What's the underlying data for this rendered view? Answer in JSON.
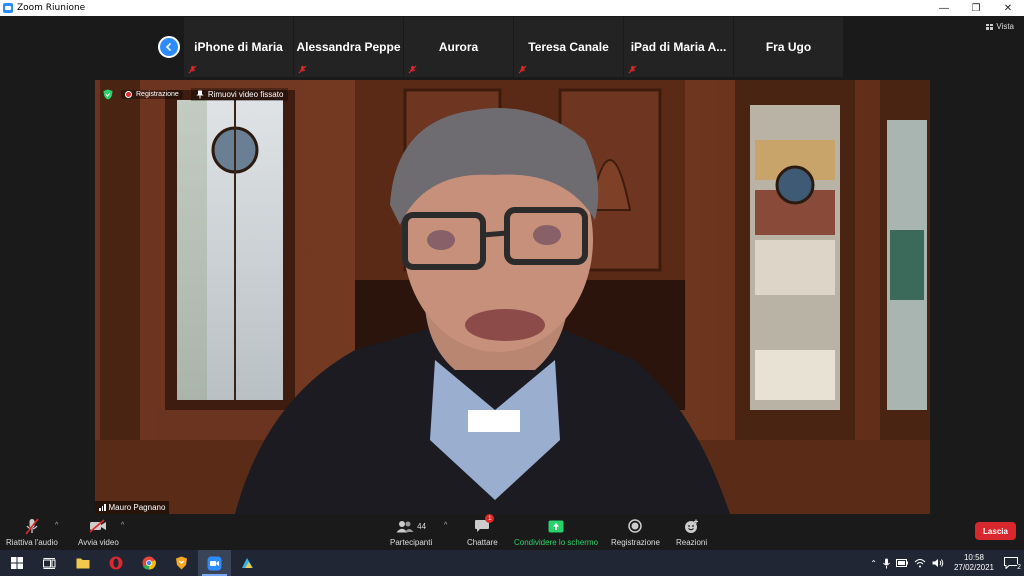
{
  "window": {
    "title": "Zoom Riunione",
    "controls": {
      "minimize": "—",
      "restore": "❐",
      "close": "✕"
    }
  },
  "view_button": {
    "label": "Vista"
  },
  "participants_strip": [
    {
      "name": "iPhone di Maria",
      "muted": true
    },
    {
      "name": "Alessandra Peppe",
      "muted": true
    },
    {
      "name": "Aurora",
      "muted": true
    },
    {
      "name": "Teresa Canale",
      "muted": true
    },
    {
      "name": "iPad di Maria A...",
      "muted": true
    },
    {
      "name": "Fra Ugo",
      "muted": false
    }
  ],
  "main_video": {
    "recording_label": "Registrazione",
    "unpin_label": "Rimuovi video fissato",
    "speaker_name": "Mauro Pagnano"
  },
  "toolbar": {
    "audio_label": "Riattiva l'audio",
    "video_label": "Avvia video",
    "participants_label": "Partecipanti",
    "participants_count": "44",
    "chat_label": "Chattare",
    "chat_badge": "1",
    "share_label": "Condividere lo schermo",
    "record_label": "Registrazione",
    "reactions_label": "Reazioni",
    "leave_label": "Lascia"
  },
  "taskbar": {
    "time": "10:58",
    "date": "27/02/2021",
    "notifications": "2"
  },
  "colors": {
    "accent": "#2d8cff",
    "leave": "#d9272e",
    "share": "#27d36a",
    "mute": "#e02828"
  }
}
